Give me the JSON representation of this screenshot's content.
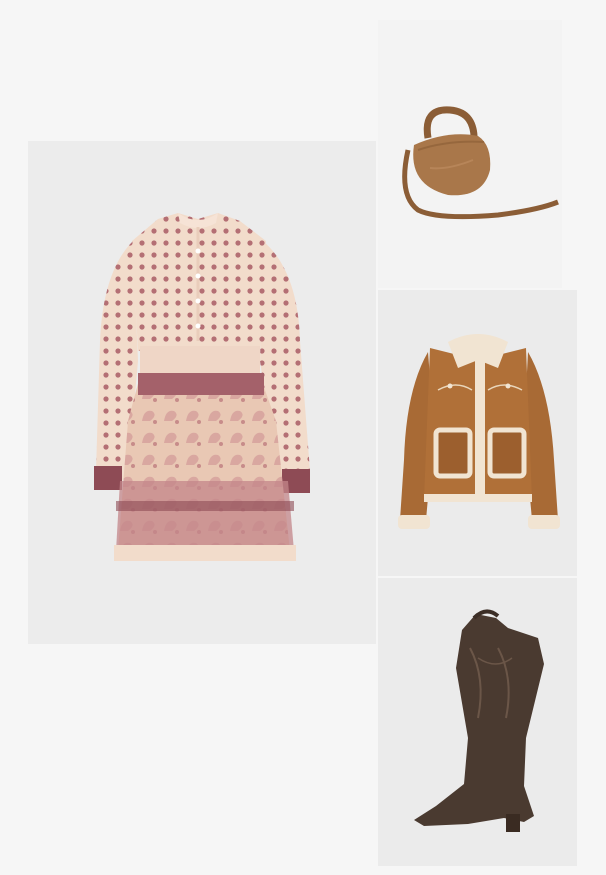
{
  "outfit": {
    "items": [
      {
        "id": "dress",
        "product": "paisley-print-mini-dress-icon",
        "palette": {
          "base": "#f2dccb",
          "accent": "#b06f72",
          "trim": "#8e4b55"
        }
      },
      {
        "id": "bag",
        "product": "ruched-crossbody-bag-icon",
        "palette": {
          "base": "#a9774a",
          "shade": "#8b5d36"
        }
      },
      {
        "id": "jacket",
        "product": "shearling-suede-jacket-icon",
        "palette": {
          "base": "#a86a35",
          "fleece": "#f1e4d2"
        }
      },
      {
        "id": "boot",
        "product": "western-cowboy-boot-icon",
        "palette": {
          "base": "#4a3a30",
          "stitch": "#6b5648"
        }
      }
    ]
  }
}
